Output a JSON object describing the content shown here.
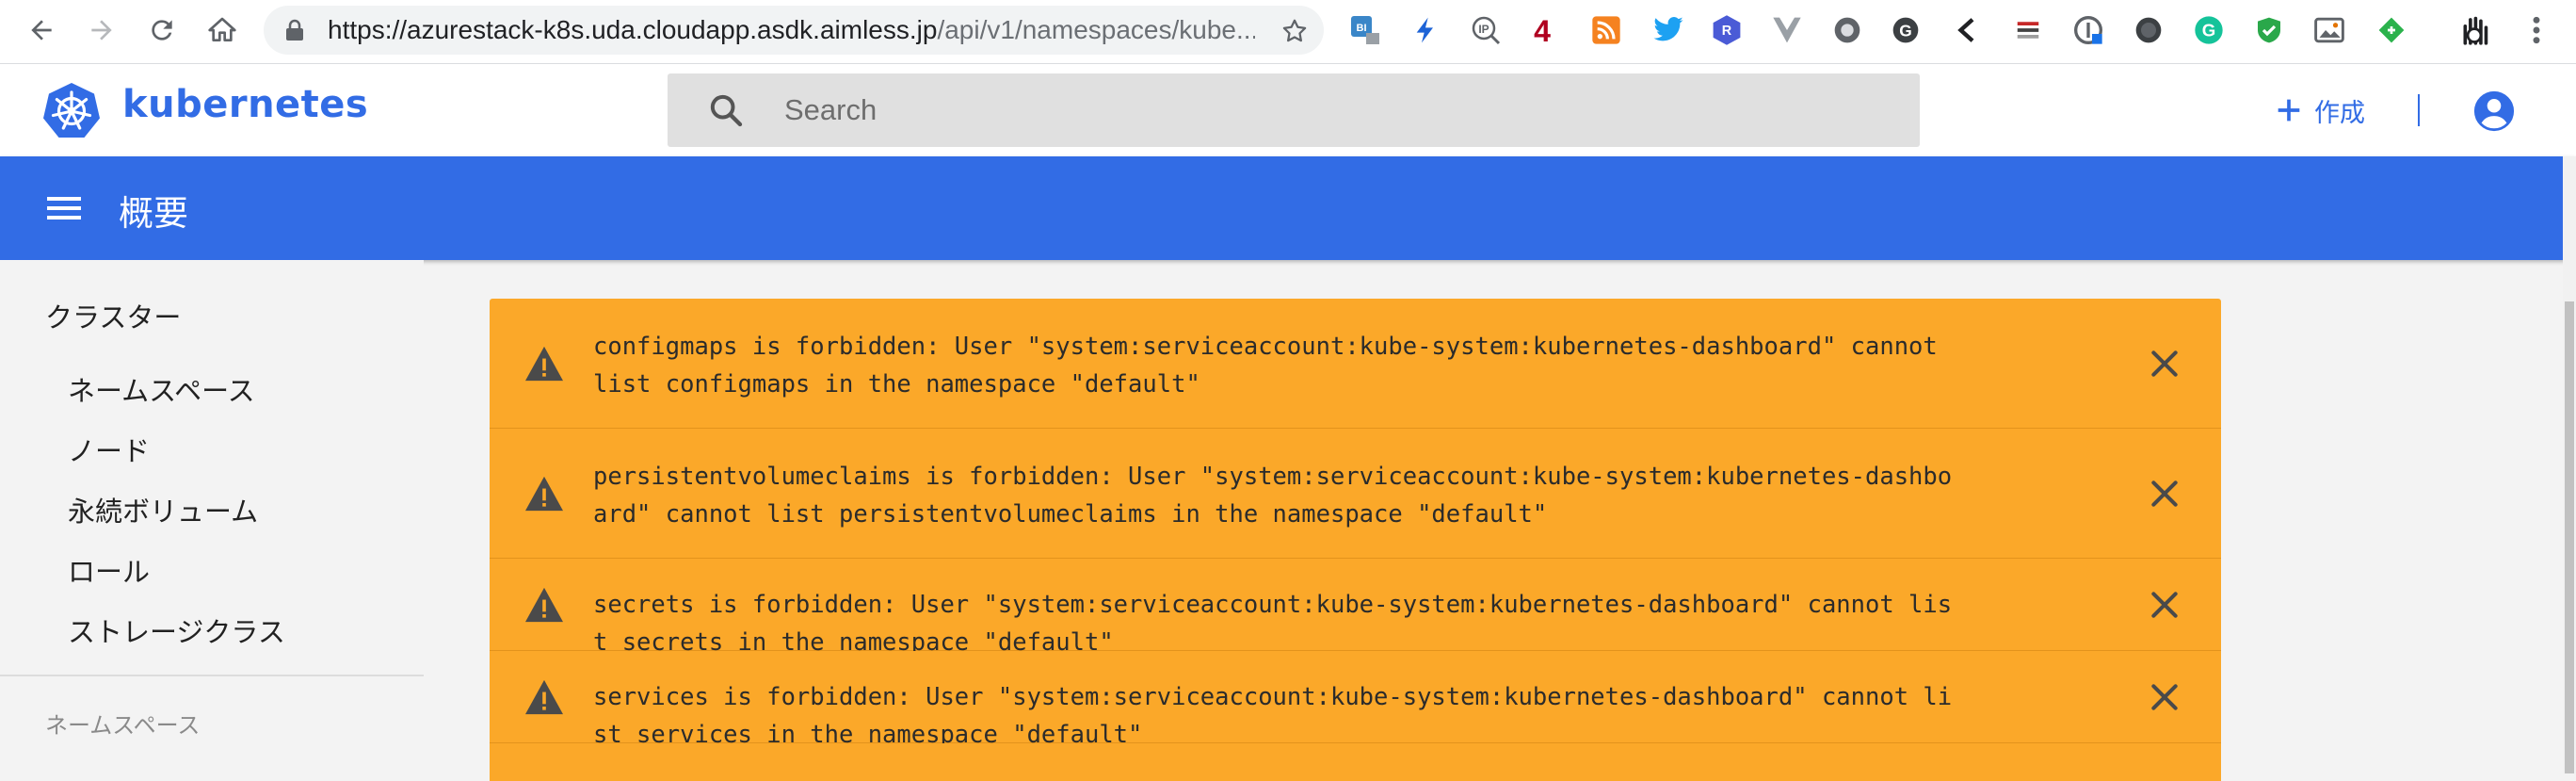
{
  "browser": {
    "url_host": "https://azurestack-k8s.uda.cloudapp.asdk.aimless.jp",
    "url_path": "/api/v1/namespaces/kube...",
    "extensions": [
      {
        "icon": "bitly-extension-icon",
        "label": "BI"
      },
      {
        "icon": "lightning-extension-icon",
        "label": ""
      },
      {
        "icon": "ip-whois-extension-icon",
        "label": "IP"
      },
      {
        "icon": "four-extension-icon",
        "label": "4"
      },
      {
        "icon": "rss-extension-icon",
        "label": ""
      },
      {
        "icon": "twitter-extension-icon",
        "label": ""
      },
      {
        "icon": "r-extension-icon",
        "label": "R"
      },
      {
        "icon": "vue-devtools-extension-icon",
        "label": ""
      },
      {
        "icon": "circle-extension-icon",
        "label": ""
      },
      {
        "icon": "g-circle-extension-icon",
        "label": ""
      },
      {
        "icon": "chevron-left-extension-icon",
        "label": ""
      },
      {
        "icon": "flag-list-extension-icon",
        "label": ""
      },
      {
        "icon": "dark-reader-extension-icon",
        "label": ""
      },
      {
        "icon": "dark-circle-extension-icon",
        "label": ""
      },
      {
        "icon": "grammarly-extension-icon",
        "label": "G"
      },
      {
        "icon": "shield-check-extension-icon",
        "label": ""
      },
      {
        "icon": "screenshot-extension-icon",
        "label": ""
      },
      {
        "icon": "feedly-extension-icon",
        "label": ""
      },
      {
        "icon": "hand-extension-icon",
        "label": ""
      }
    ],
    "colors": {
      "bitly": "#3a86c8",
      "lightning": "#1d63d6",
      "four": "#b00020",
      "rss": "#f58220",
      "twitter": "#1da1f2",
      "r": "#4a5bd6",
      "grammarly": "#15c39a",
      "shield": "#2aa84a",
      "feedly": "#2bb24c"
    }
  },
  "app": {
    "brand": "kubernetes",
    "search_placeholder": "Search",
    "create_label": "作成",
    "page_title": "概要",
    "brand_color": "#326ce5",
    "alert_color": "#fba829"
  },
  "sidebar": {
    "section": "クラスター",
    "items": [
      {
        "label": "ネームスペース"
      },
      {
        "label": "ノード"
      },
      {
        "label": "永続ボリューム"
      },
      {
        "label": "ロール"
      },
      {
        "label": "ストレージクラス"
      }
    ],
    "namespace_label": "ネームスペース"
  },
  "alerts": [
    {
      "message": "configmaps is forbidden: User \"system:serviceaccount:kube-system:kubernetes-dashboard\" cannot list configmaps in the namespace \"default\""
    },
    {
      "message": "persistentvolumeclaims is forbidden: User \"system:serviceaccount:kube-system:kubernetes-dashboard\" cannot list persistentvolumeclaims in the namespace \"default\""
    },
    {
      "message": "secrets is forbidden: User \"system:serviceaccount:kube-system:kubernetes-dashboard\" cannot list secrets in the namespace \"default\""
    },
    {
      "message": "services is forbidden: User \"system:serviceaccount:kube-system:kubernetes-dashboard\" cannot list services in the namespace \"default\""
    },
    {
      "message": ""
    }
  ]
}
